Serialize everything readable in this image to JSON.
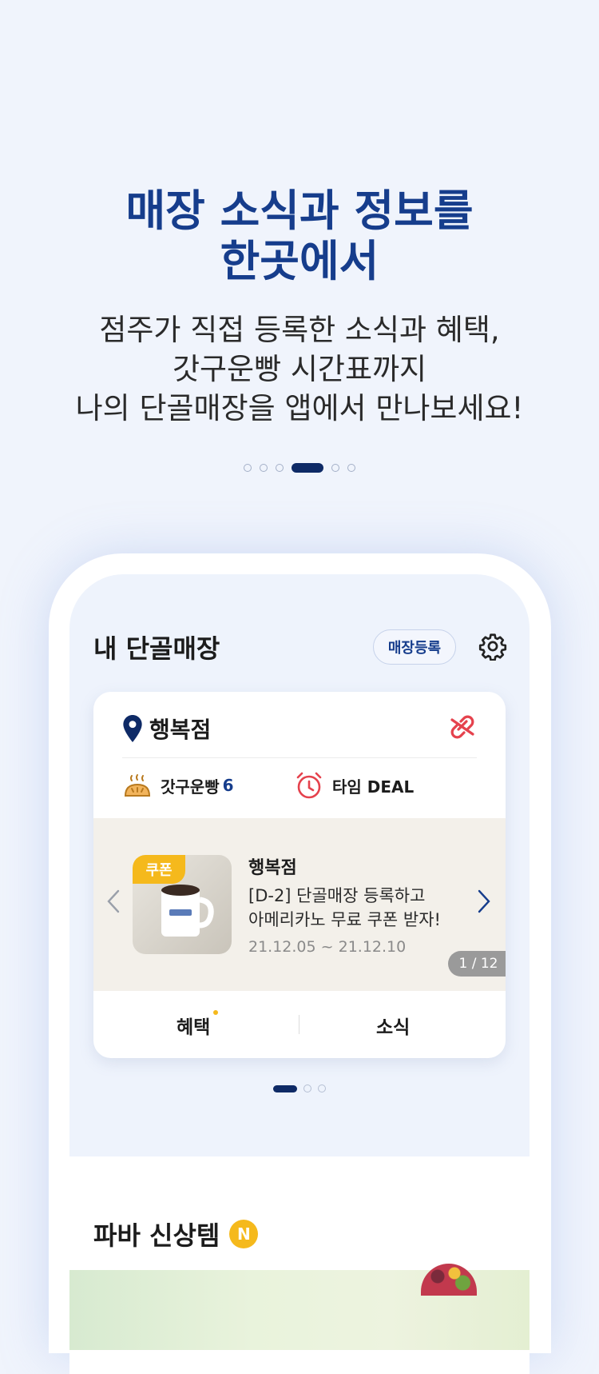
{
  "intro": {
    "headline_line1": "매장 소식과 정보를",
    "headline_line2": "한곳에서",
    "sub_line1": "점주가 직접 등록한 소식과 혜택,",
    "sub_line2": "갓구운빵 시간표까지",
    "sub_line3": "나의 단골매장을 앱에서 만나보세요!",
    "pager": {
      "total": 6,
      "active_index": 3
    }
  },
  "my_store": {
    "title": "내 단골매장",
    "register_button": "매장등록",
    "settings_icon": "gear-icon",
    "store_name": "행복점",
    "fresh_bread_label": "갓구운빵",
    "fresh_bread_count": "6",
    "time_deal_label": "타임 DEAL",
    "promo": {
      "tag": "쿠폰",
      "store": "행복점",
      "desc_line1": "[D-2] 단골매장 등록하고",
      "desc_line2": "아메리카노 무료 쿠폰 받자!",
      "date": "21.12.05 ~ 21.12.10",
      "page": "1 / 12"
    },
    "tabs": [
      "혜택",
      "소식"
    ],
    "card_pager": {
      "total": 3,
      "active_index": 0
    }
  },
  "new_items": {
    "title": "파바 신상템",
    "badge": "N"
  },
  "colors": {
    "brand_navy": "#163d8c",
    "accent_yellow": "#f5b91c",
    "unlink_red": "#e5424d"
  }
}
